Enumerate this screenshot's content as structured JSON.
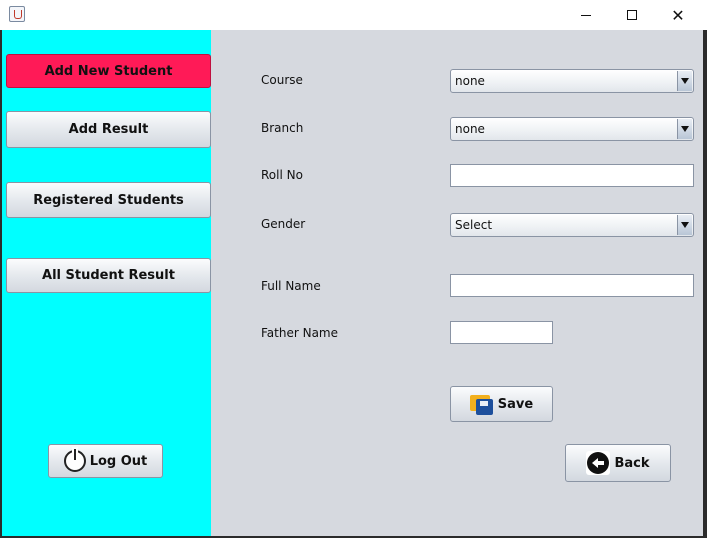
{
  "window": {
    "controls": {
      "minimize_icon": "minimize-icon",
      "maximize_icon": "maximize-icon",
      "close_icon": "close-icon",
      "close_glyph": "✕"
    }
  },
  "sidebar": {
    "background": "#00ffff",
    "active_color": "#ff1a57",
    "items": [
      {
        "label": "Add New Student",
        "active": true
      },
      {
        "label": "Add Result",
        "active": false
      },
      {
        "label": "Registered Students",
        "active": false
      },
      {
        "label": "All Student Result",
        "active": false
      }
    ],
    "logout_label": "Log Out"
  },
  "form": {
    "course": {
      "label": "Course",
      "value": "none"
    },
    "branch": {
      "label": "Branch",
      "value": "none"
    },
    "roll_no": {
      "label": "Roll No",
      "value": ""
    },
    "gender": {
      "label": "Gender",
      "value": "Select"
    },
    "full_name": {
      "label": "Full Name",
      "value": ""
    },
    "father_name": {
      "label": "Father Name",
      "value": ""
    },
    "save_label": "Save",
    "back_label": "Back"
  }
}
